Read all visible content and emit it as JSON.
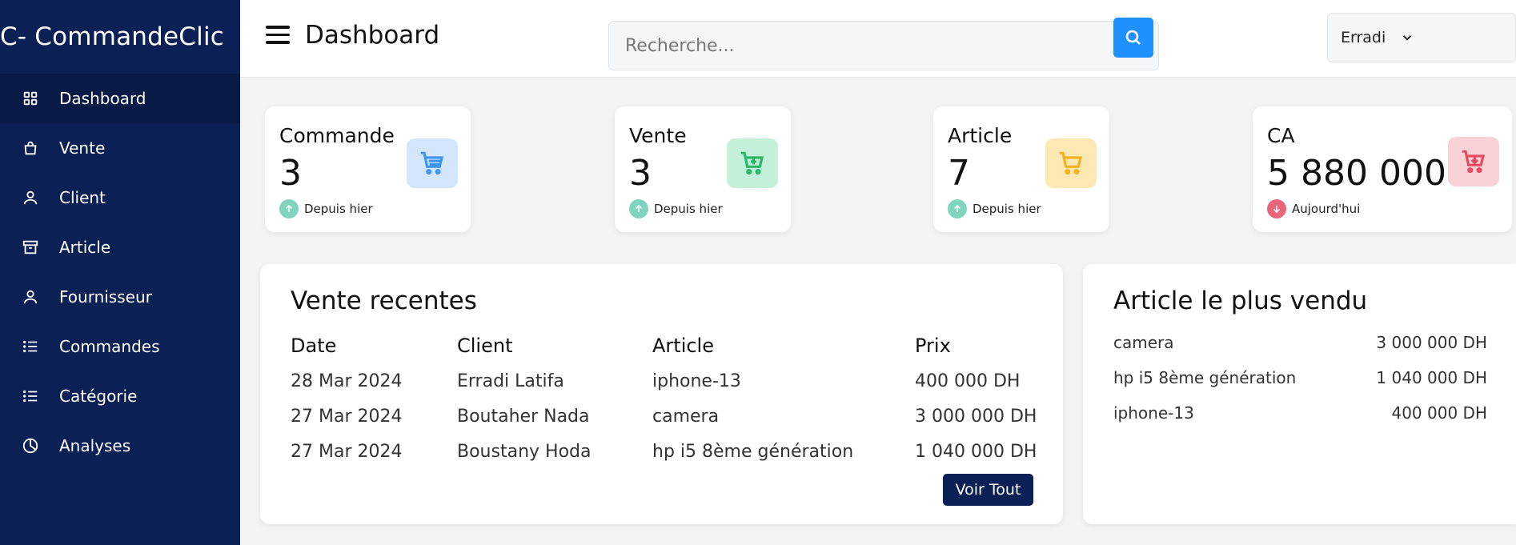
{
  "app": {
    "brand": "C- CommandeClic"
  },
  "sidebar": {
    "items": [
      {
        "label": "Dashboard",
        "icon": "grid-icon"
      },
      {
        "label": "Vente",
        "icon": "shopping-bag-icon"
      },
      {
        "label": "Client",
        "icon": "user-icon"
      },
      {
        "label": "Article",
        "icon": "archive-icon"
      },
      {
        "label": "Fournisseur",
        "icon": "user-icon"
      },
      {
        "label": "Commandes",
        "icon": "list-icon"
      },
      {
        "label": "Catégorie",
        "icon": "list-icon"
      },
      {
        "label": "Analyses",
        "icon": "pie-chart-icon"
      }
    ]
  },
  "header": {
    "title": "Dashboard",
    "search_placeholder": "Recherche...",
    "user": "Erradi"
  },
  "stats": [
    {
      "label": "Commande",
      "value": "3",
      "note": "Depuis hier",
      "trend": "up",
      "icon_bg": "#d3e6fb",
      "icon_color": "#3c95f0"
    },
    {
      "label": "Vente",
      "value": "3",
      "note": "Depuis hier",
      "trend": "up",
      "icon_bg": "#c4f0d9",
      "icon_color": "#22b865"
    },
    {
      "label": "Article",
      "value": "7",
      "note": "Depuis hier",
      "trend": "up",
      "icon_bg": "#fde8b4",
      "icon_color": "#f3b11c"
    },
    {
      "label": "CA",
      "value": "5 880 000",
      "note": "Aujourd'hui",
      "trend": "down",
      "icon_bg": "#f8d2d7",
      "icon_color": "#e6485e"
    }
  ],
  "recent": {
    "title": "Vente recentes",
    "headers": [
      "Date",
      "Client",
      "Article",
      "Prix"
    ],
    "rows": [
      [
        "28 Mar 2024",
        "Erradi Latifa",
        "iphone-13",
        "400 000 DH"
      ],
      [
        "27 Mar 2024",
        "Boutaher Nada",
        "camera",
        "3 000 000 DH"
      ],
      [
        "27 Mar 2024",
        "Boustany Hoda",
        "hp i5 8ème génération",
        "1 040 000 DH"
      ]
    ],
    "button": "Voir Tout"
  },
  "best": {
    "title": "Article le plus vendu",
    "rows": [
      {
        "name": "camera",
        "amount": "3 000 000 DH"
      },
      {
        "name": "hp i5 8ème génération",
        "amount": "1 040 000 DH"
      },
      {
        "name": "iphone-13",
        "amount": "400 000 DH"
      }
    ]
  },
  "colors": {
    "sidebar": "#0b2155",
    "accent": "#1e90ff",
    "trend_up": "#7fd3bf",
    "trend_down": "#e8667a"
  }
}
